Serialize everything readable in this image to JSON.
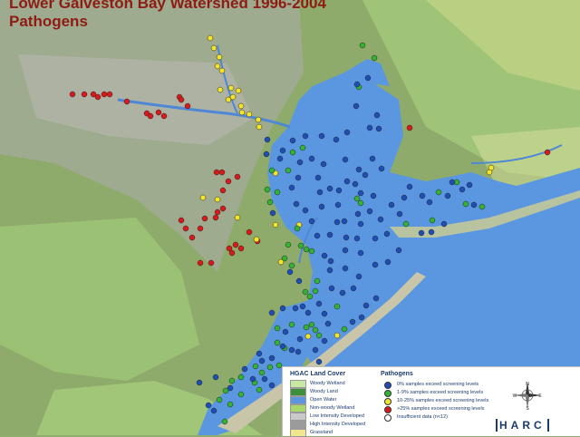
{
  "title": {
    "line1": "Lower Galveston Bay Watershed 1996-2004",
    "line2": "Pathogens"
  },
  "legend": {
    "land_cover_title": "HGAC Land Cover",
    "land_cover": [
      {
        "label": "Woody Wetland",
        "color": "#c7e9a3"
      },
      {
        "label": "Woody Land",
        "color": "#3c8f3c"
      },
      {
        "label": "Open Water",
        "color": "#5b97e0"
      },
      {
        "label": "Non-woody Wetland",
        "color": "#a8d86a"
      },
      {
        "label": "Low Intensity Developed",
        "color": "#c9c9c9"
      },
      {
        "label": "High Intensity Developed",
        "color": "#9b9b9b"
      },
      {
        "label": "Grassland",
        "color": "#f0e68c"
      }
    ],
    "pathogens_title": "Pathogens",
    "pathogens": [
      {
        "label": "0% samples exceed screening levels",
        "color": "#1f4fb4"
      },
      {
        "label": "1-9% samples exceed screening levels",
        "color": "#33b233"
      },
      {
        "label": "10-25% samples exceed screening levels",
        "color": "#f2e32c"
      },
      {
        "label": ">25% samples exceed screening levels",
        "color": "#d91a1a"
      },
      {
        "label": "Insufficient data (n<12)",
        "color": "#ffffff"
      }
    ]
  },
  "compass": {
    "n": "N",
    "s": "S",
    "e": "E",
    "w": "W"
  },
  "logo": {
    "text": "HARC"
  }
}
